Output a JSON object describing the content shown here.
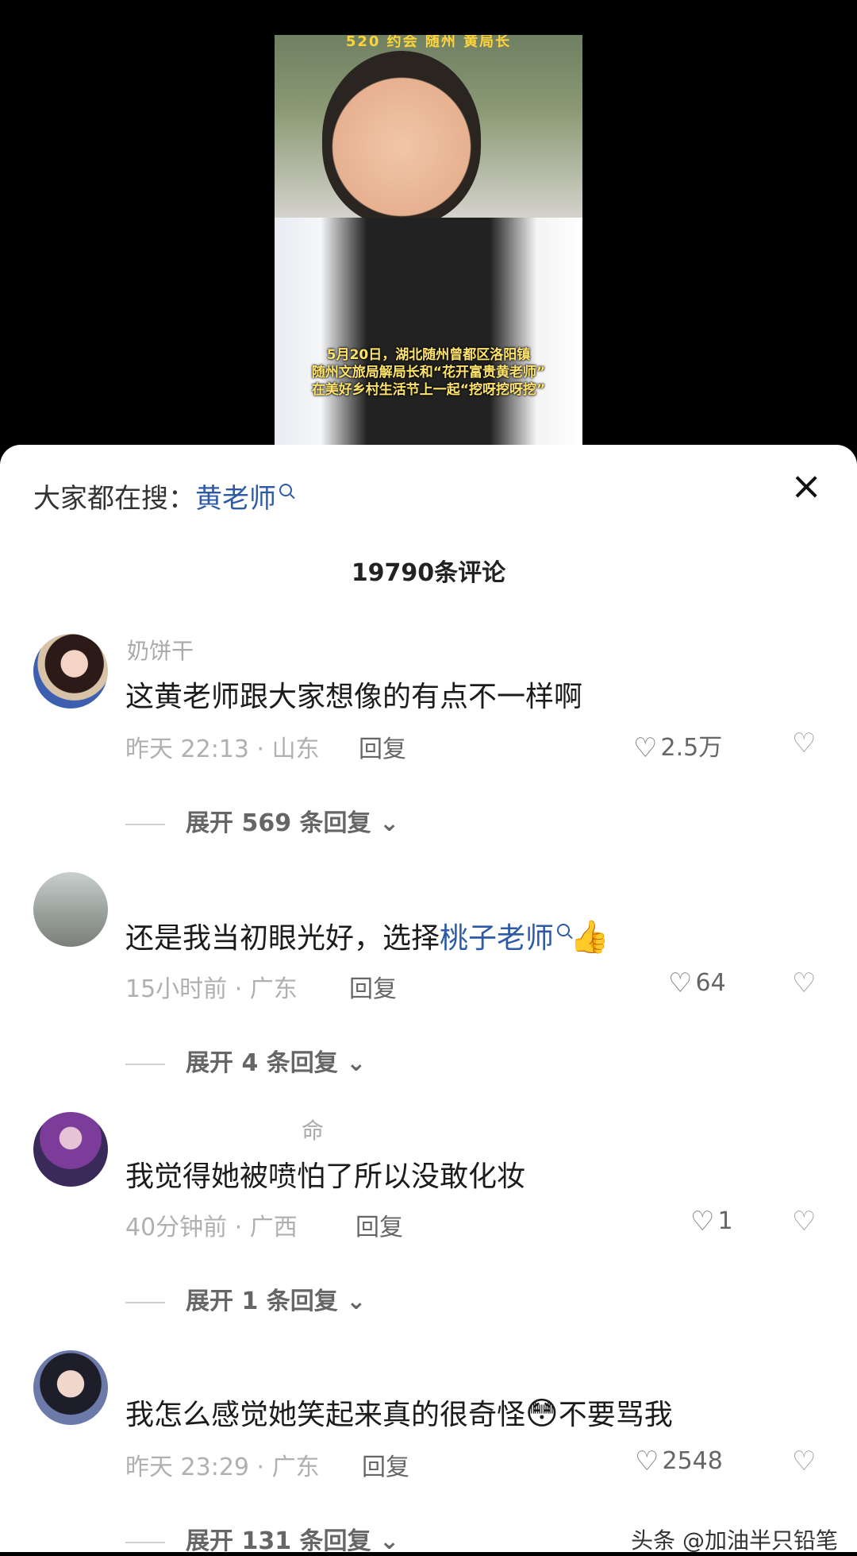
{
  "video": {
    "banner": "520 约会 随州 黄局长",
    "caption_lines": [
      "5月20日，湖北随州曾都区洛阳镇",
      "随州文旅局解局长和“花开富贵黄老师”",
      "在美好乡村生活节上一起“挖呀挖呀挖”"
    ]
  },
  "search": {
    "label": "大家都在搜：",
    "keyword": "黄老师"
  },
  "comments_count": "19790条评论",
  "comments": [
    {
      "username": "奶饼干",
      "text": "这黄老师跟大家想像的有点不一样啊",
      "meta": "昨天 22:13 · 山东",
      "reply": "回复",
      "likes": "2.5万",
      "expand": "展开 569 条回复"
    },
    {
      "username": "",
      "text_pre": "还是我当初眼光好，选择",
      "text_link": "桃子老师",
      "text_emoji": "👍",
      "meta": "15小时前 · 广东",
      "reply": "回复",
      "likes": "64",
      "expand": "展开 4 条回复"
    },
    {
      "username": "命",
      "text": "我觉得她被喷怕了所以没敢化妆",
      "meta": "40分钟前 · 广西",
      "reply": "回复",
      "likes": "1",
      "expand": "展开 1 条回复"
    },
    {
      "username": "",
      "text_pre": "我怎么感觉她笑起来真的很奇怪",
      "text_emoji": "😳",
      "text_post": "不要骂我",
      "meta": "昨天 23:29 · 广东",
      "reply": "回复",
      "likes": "2548",
      "expand": "展开 131 条回复"
    }
  ],
  "watermark": "头条 @加油半只铅笔"
}
